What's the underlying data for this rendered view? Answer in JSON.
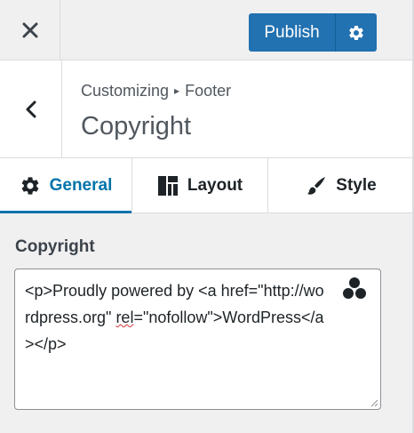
{
  "topbar": {
    "close_icon": "close-icon",
    "publish_label": "Publish",
    "publish_settings_icon": "gear-icon",
    "accent_color": "#2271b1"
  },
  "section": {
    "back_icon": "chevron-left-icon",
    "breadcrumb_parent": "Customizing",
    "breadcrumb_separator": "▸",
    "breadcrumb_current": "Footer",
    "title": "Copyright"
  },
  "tabs": [
    {
      "label": "General",
      "icon": "gear-icon",
      "active": true
    },
    {
      "label": "Layout",
      "icon": "layout-icon",
      "active": false
    },
    {
      "label": "Style",
      "icon": "brush-icon",
      "active": false
    }
  ],
  "field": {
    "label": "Copyright",
    "value_line1": "<p>Proudly powered by <a ",
    "value_line2": "href=\"http://wordpress.org\" ",
    "value_rel": "rel",
    "value_line3_rest": "=\"nofollow\">WordPress</a></p>",
    "dynamic_icon": "dynamic-content-icon"
  }
}
